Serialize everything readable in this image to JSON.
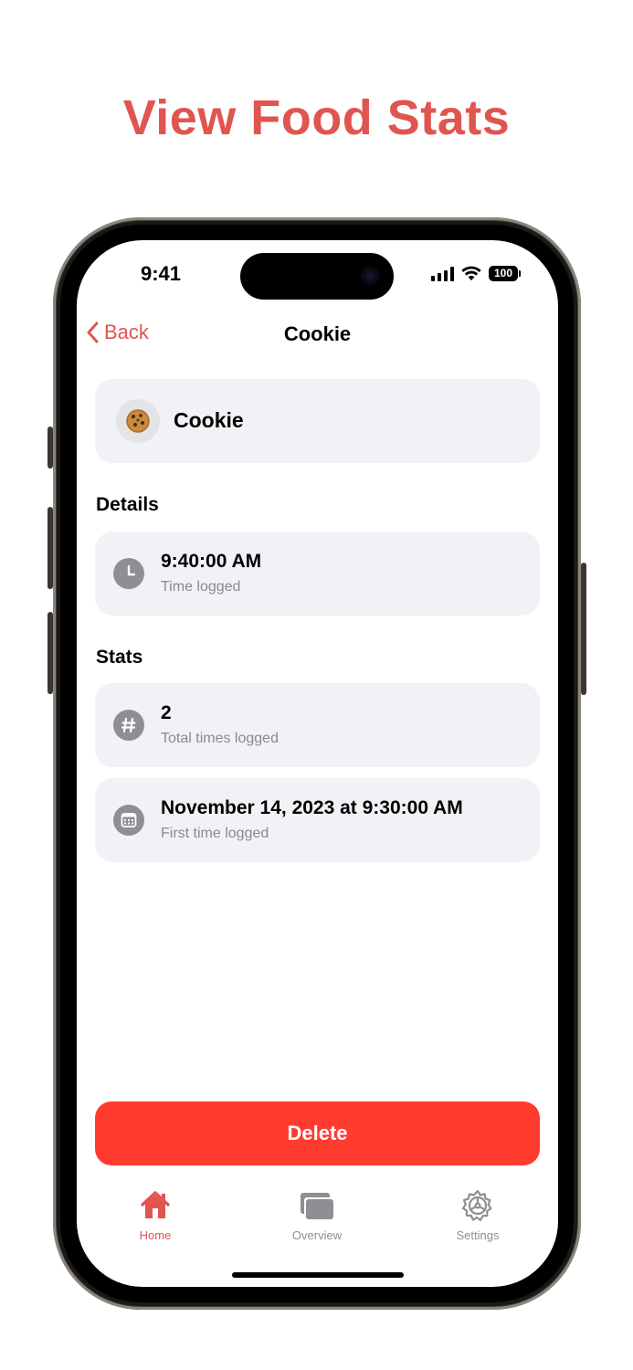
{
  "headline": "View Food Stats",
  "status_bar": {
    "time": "9:41",
    "battery": "100"
  },
  "nav": {
    "back_label": "Back",
    "title": "Cookie"
  },
  "food": {
    "emoji": "🍪",
    "name": "Cookie"
  },
  "details": {
    "heading": "Details",
    "time_value": "9:40:00 AM",
    "time_label": "Time logged"
  },
  "stats": {
    "heading": "Stats",
    "total_value": "2",
    "total_label": "Total times logged",
    "first_value": "November 14, 2023 at 9:30:00 AM",
    "first_label": "First time logged"
  },
  "actions": {
    "delete_label": "Delete"
  },
  "tabs": [
    {
      "label": "Home",
      "active": true
    },
    {
      "label": "Overview",
      "active": false
    },
    {
      "label": "Settings",
      "active": false
    }
  ],
  "colors": {
    "accent": "#e05550",
    "destructive": "#ff3b30",
    "card_bg": "#f2f2f6",
    "icon_gray": "#8e8e93",
    "inactive_tab": "#8e8e93"
  }
}
